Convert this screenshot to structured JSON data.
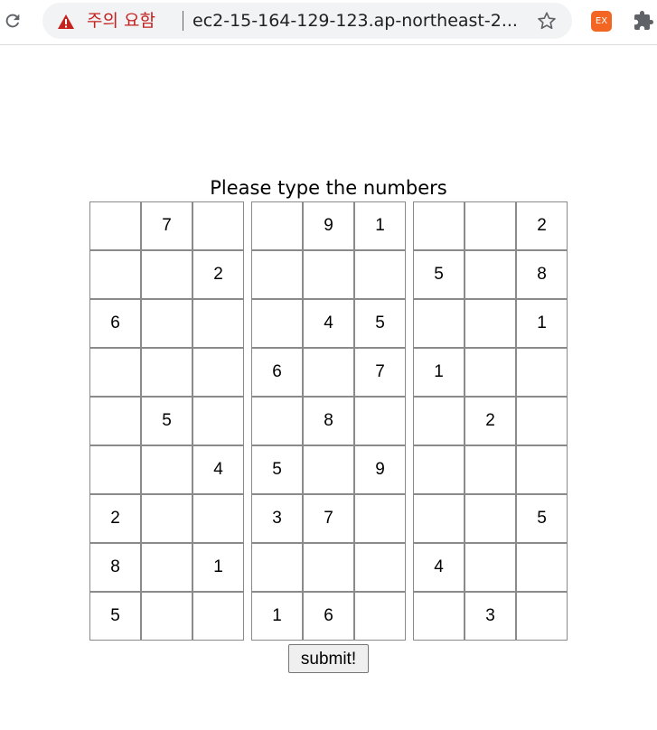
{
  "browser": {
    "security_warning": "주의 요함",
    "url": "ec2-15-164-129-123.ap-northeast-2...",
    "extension_label": "EX"
  },
  "page": {
    "title": "Please type the numbers",
    "submit_label": "submit!"
  },
  "grid": [
    [
      "",
      "7",
      "",
      "",
      "9",
      "1",
      "",
      "",
      "2"
    ],
    [
      "",
      "",
      "2",
      "",
      "",
      "",
      "5",
      "",
      "8"
    ],
    [
      "6",
      "",
      "",
      "",
      "4",
      "5",
      "",
      "",
      "1"
    ],
    [
      "",
      "",
      "",
      "6",
      "",
      "7",
      "1",
      "",
      ""
    ],
    [
      "",
      "5",
      "",
      "",
      "8",
      "",
      "",
      "2",
      ""
    ],
    [
      "",
      "",
      "4",
      "5",
      "",
      "9",
      "",
      "",
      ""
    ],
    [
      "2",
      "",
      "",
      "3",
      "7",
      "",
      "",
      "",
      "5"
    ],
    [
      "8",
      "",
      "1",
      "",
      "",
      "",
      "4",
      "",
      ""
    ],
    [
      "5",
      "",
      "",
      "1",
      "6",
      "",
      "",
      "3",
      ""
    ]
  ]
}
